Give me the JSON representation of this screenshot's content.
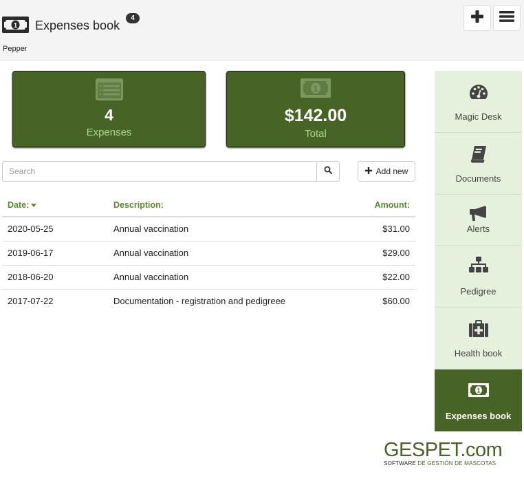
{
  "header": {
    "title": "Expenses book",
    "badge_count": "4",
    "subtitle": "Pepper",
    "icons": {
      "logo": "money-bill-icon",
      "add": "plus-icon",
      "menu": "hamburger-menu-icon"
    }
  },
  "cards": [
    {
      "icon": "list-icon",
      "value": "4",
      "label": "Expenses"
    },
    {
      "icon": "money-bill-icon",
      "value": "$142.00",
      "label": "Total"
    }
  ],
  "search": {
    "placeholder": "Search",
    "value": "",
    "icon": "search-icon"
  },
  "add_new": {
    "label": "Add new",
    "icon": "plus-icon"
  },
  "table": {
    "columns": [
      "Date:",
      "Description:",
      "Amount:"
    ],
    "sort": {
      "column": "Date:",
      "direction": "desc"
    },
    "rows": [
      {
        "date": "2020-05-25",
        "description": "Annual vaccination",
        "amount": "$31.00"
      },
      {
        "date": "2019-06-17",
        "description": "Annual vaccination",
        "amount": "$29.00"
      },
      {
        "date": "2018-06-20",
        "description": "Annual vaccination",
        "amount": "$22.00"
      },
      {
        "date": "2017-07-22",
        "description": "Documentation - registration and pedigreee",
        "amount": "$60.00"
      }
    ]
  },
  "sidebar": {
    "items": [
      {
        "label": "Magic Desk",
        "icon": "dashboard-gauge-icon",
        "active": false
      },
      {
        "label": "Documents",
        "icon": "book-icon",
        "active": false
      },
      {
        "label": "Alerts",
        "icon": "megaphone-icon",
        "active": false
      },
      {
        "label": "Pedigree",
        "icon": "sitemap-icon",
        "active": false
      },
      {
        "label": "Health book",
        "icon": "medkit-icon",
        "active": false
      },
      {
        "label": "Expenses book",
        "icon": "money-bill-icon",
        "active": true
      }
    ]
  },
  "brand": {
    "name": "GESPET.com",
    "tagline_part1": "SOFTWARE ",
    "tagline_part2": "DE GESTIÓN DE MASCOTAS"
  },
  "colors": {
    "primary_green": "#476325",
    "header_green_text": "#5a8a2c",
    "card_label_green": "#a9d88a",
    "sidebar_bg": "#e5f1dc"
  }
}
